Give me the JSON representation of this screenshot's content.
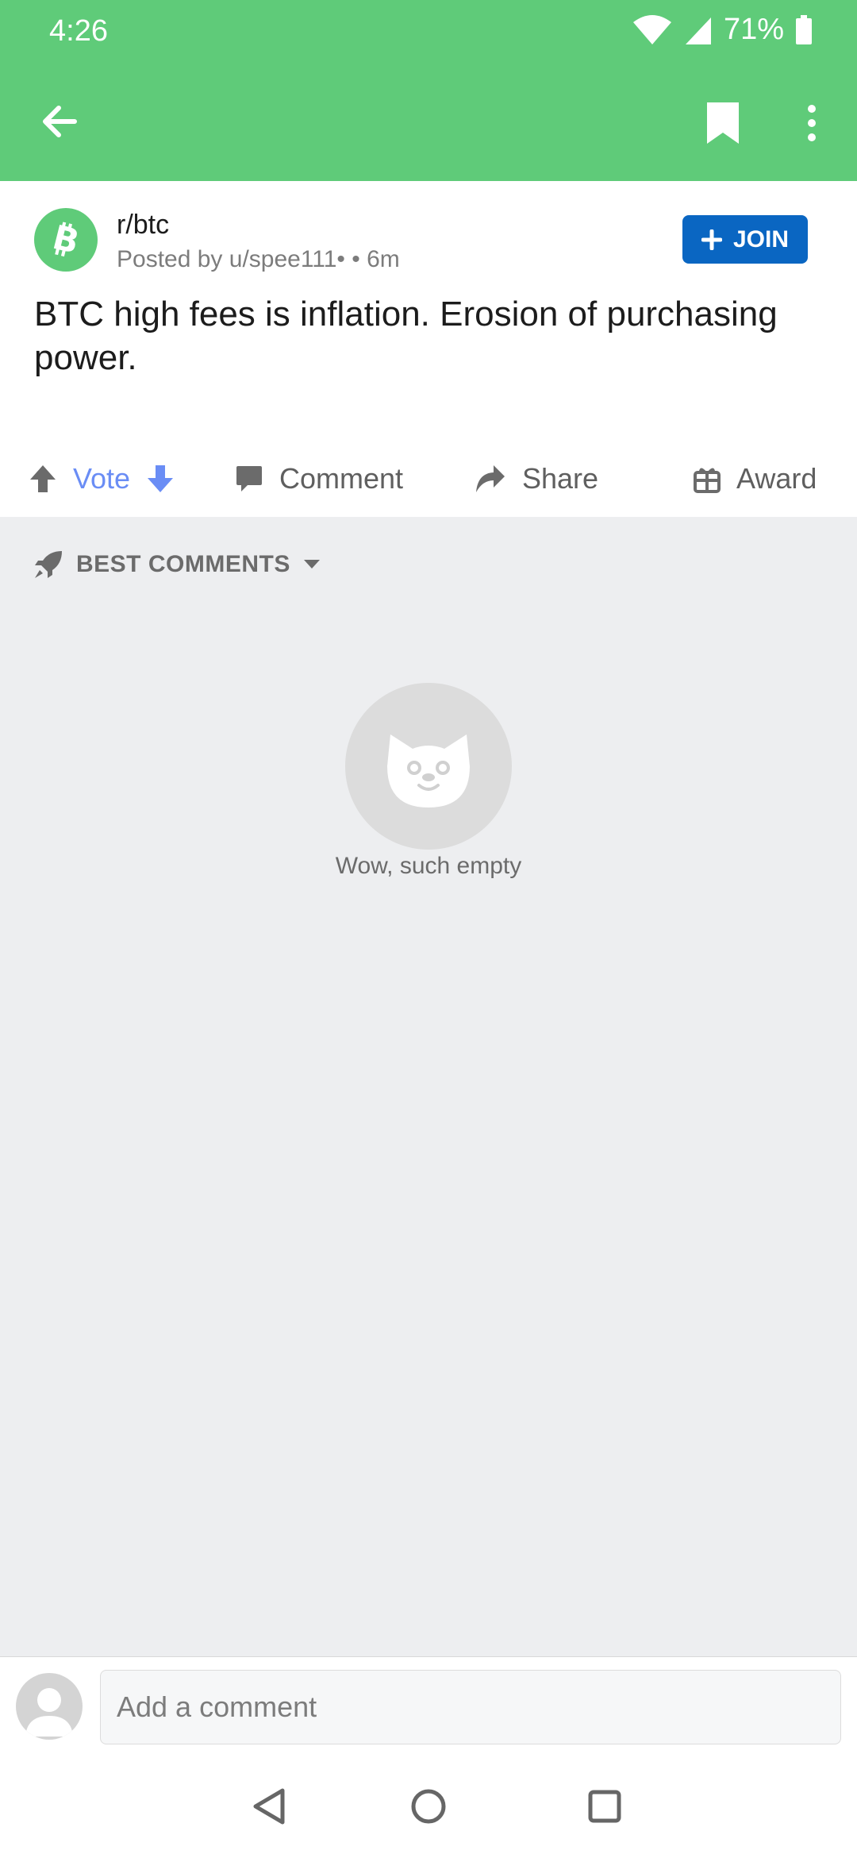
{
  "status_bar": {
    "time": "4:26",
    "battery": "71%"
  },
  "post": {
    "subreddit": "r/btc",
    "posted_by": "Posted by u/spee111•",
    "age": " • 6m",
    "join_label": "JOIN",
    "title": "BTC high fees is inflation. Erosion of purchasing power."
  },
  "actions": {
    "vote": "Vote",
    "comment": "Comment",
    "share": "Share",
    "award": "Award"
  },
  "comments": {
    "sort_label": "BEST COMMENTS",
    "empty_text": "Wow, such empty"
  },
  "comment_bar": {
    "placeholder": "Add a comment"
  },
  "colors": {
    "header": "#5fcb79",
    "join": "#0a66c2",
    "vote_accent": "#6a8df5"
  }
}
